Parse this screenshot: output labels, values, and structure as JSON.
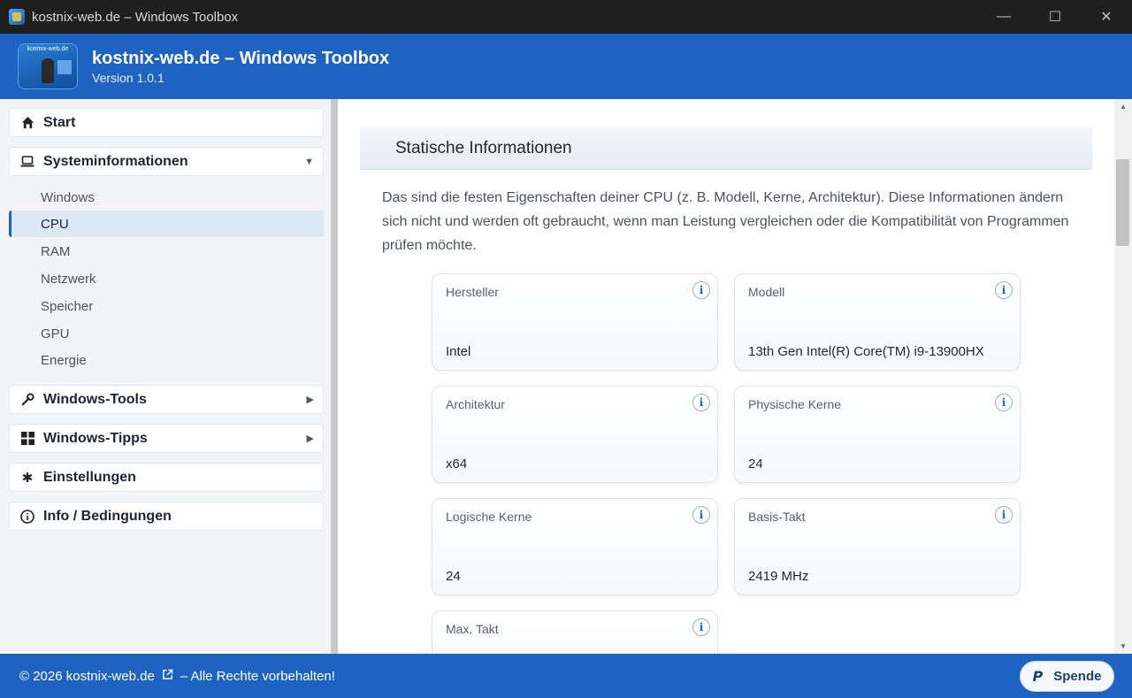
{
  "window": {
    "title": "kostnix-web.de – Windows Toolbox",
    "minimize": "—",
    "maximize": "☐",
    "close": "✕"
  },
  "header": {
    "logo_text": "kostnix-web.de",
    "title": "kostnix-web.de – Windows Toolbox",
    "version": "Version 1.0.1"
  },
  "sidebar": {
    "start": "Start",
    "systeminfo": "Systeminformationen",
    "sub_items": [
      "Windows",
      "CPU",
      "RAM",
      "Netzwerk",
      "Speicher",
      "GPU",
      "Energie"
    ],
    "active_sub": "CPU",
    "tools": "Windows-Tools",
    "tipps": "Windows-Tipps",
    "settings": "Einstellungen",
    "info": "Info / Bedingungen"
  },
  "main": {
    "section_title": "Statische Informationen",
    "intro": "Das sind die festen Eigenschaften deiner CPU (z. B. Modell, Kerne, Architektur). Diese Informationen ändern sich nicht und werden oft gebraucht, wenn man Leistung vergleichen oder die Kompatibilität von Programmen prüfen möchte.",
    "cards": [
      {
        "label": "Hersteller",
        "value": "Intel"
      },
      {
        "label": "Modell",
        "value": "13th Gen Intel(R) Core(TM) i9-13900HX"
      },
      {
        "label": "Architektur",
        "value": "x64"
      },
      {
        "label": "Physische Kerne",
        "value": "24"
      },
      {
        "label": "Logische Kerne",
        "value": "24"
      },
      {
        "label": "Basis-Takt",
        "value": "2419 MHz"
      },
      {
        "label": "Max. Takt",
        "value": ""
      }
    ],
    "info_glyph": "i"
  },
  "footer": {
    "copyright": "© 2026 kostnix-web.de",
    "rights": "– Alle Rechte vorbehalten!",
    "donate": "Spende",
    "donate_glyph": "P"
  },
  "colors": {
    "accent": "#1f63c2",
    "titlebar": "#1f1f1f",
    "sidebar_bg": "#f2f4f7",
    "active_bg": "#dde8f7"
  }
}
